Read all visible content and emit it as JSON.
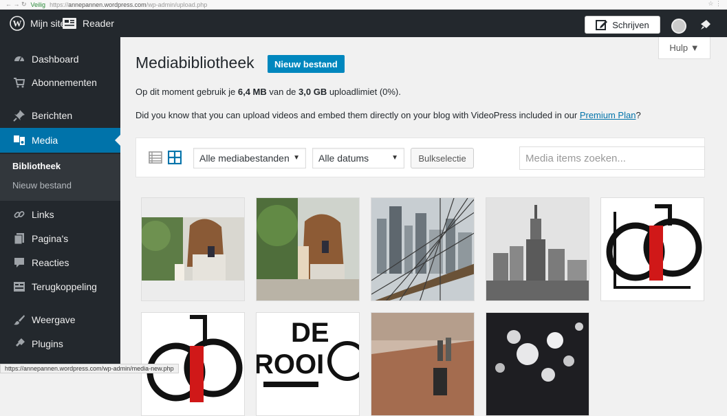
{
  "browser": {
    "secure_label": "Veilig",
    "url_prefix": "https://",
    "url_host": "annepannen.wordpress.com",
    "url_path": "/wp-admin/upload.php"
  },
  "adminbar": {
    "my_site": "Mijn site",
    "reader": "Reader",
    "write": "Schrijven"
  },
  "sidebar": {
    "items": [
      {
        "label": "Dashboard",
        "icon": "dashboard-icon"
      },
      {
        "label": "Abonnementen",
        "icon": "cart-icon"
      },
      {
        "label": "Berichten",
        "icon": "pin-icon"
      },
      {
        "label": "Media",
        "icon": "media-icon",
        "active": true
      },
      {
        "label": "Links",
        "icon": "link-icon"
      },
      {
        "label": "Pagina's",
        "icon": "page-icon"
      },
      {
        "label": "Reacties",
        "icon": "comment-icon"
      },
      {
        "label": "Terugkoppeling",
        "icon": "feedback-icon"
      },
      {
        "label": "Weergave",
        "icon": "appearance-icon"
      },
      {
        "label": "Plugins",
        "icon": "plugin-icon"
      }
    ],
    "submenu": {
      "library": "Bibliotheek",
      "add_new": "Nieuw bestand"
    }
  },
  "main": {
    "help": "Hulp ▼",
    "title": "Mediabibliotheek",
    "add_new": "Nieuw bestand",
    "storage": {
      "prefix": "Op dit moment gebruik je ",
      "used": "6,4 MB",
      "middle": " van de ",
      "limit": "3,0 GB",
      "suffix": " uploadlimiet (0%)."
    },
    "videopress": {
      "text": "Did you know that you can upload videos and embed them directly on your blog with VideoPress included in our ",
      "link": "Premium Plan",
      "end": "?"
    },
    "toolbar": {
      "filter_type": "Alle mediabestanden",
      "filter_date": "Alle datums",
      "bulk": "Bulkselectie",
      "search_placeholder": "Media items zoeken..."
    },
    "tiles": [
      {
        "name": "photo-woman-phone-1"
      },
      {
        "name": "photo-woman-phone-2"
      },
      {
        "name": "photo-city-bridge"
      },
      {
        "name": "photo-empire-state"
      },
      {
        "name": "logo-cp-1"
      },
      {
        "name": "logo-cp-2"
      },
      {
        "name": "logo-de-rooi"
      },
      {
        "name": "photo-table-bottles"
      },
      {
        "name": "photo-lights"
      }
    ]
  },
  "status_url": "https://annepannen.wordpress.com/wp-admin/media-new.php"
}
